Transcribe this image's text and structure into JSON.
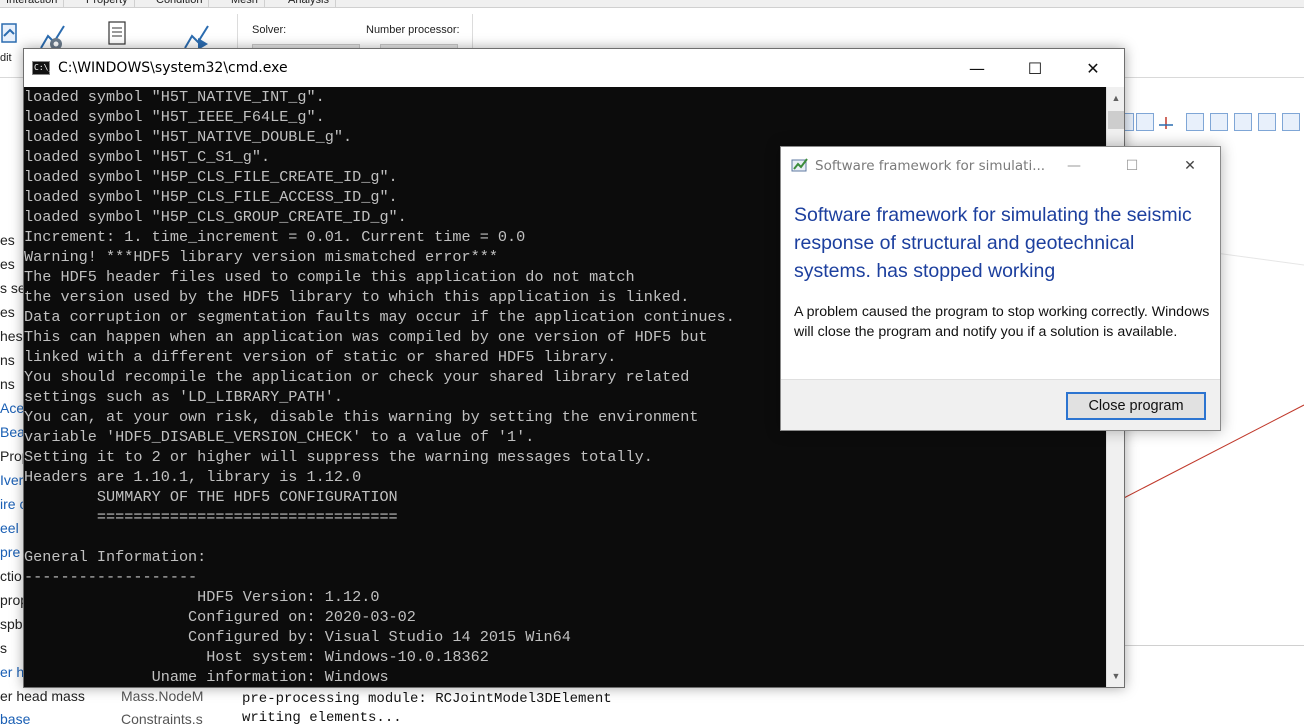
{
  "ribbon": {
    "tabs": [
      "Interaction",
      "Property",
      "Condition",
      "Mesh",
      "Analysis"
    ],
    "edit_label": "dit",
    "solver_label": "Solver:",
    "number_processor_label": "Number processor:"
  },
  "tree": {
    "left_items": [
      "es",
      "es",
      "s set",
      "es",
      "hes",
      "ns",
      "ns",
      "Acel",
      "Bear",
      "Prop",
      "Iver",
      "ire c",
      "eel",
      "pre",
      "ctio",
      "prop",
      "spb",
      "s",
      "er he",
      "er head mass",
      "base"
    ],
    "right_items": [
      "Mass.NodeM",
      "Constraints.s"
    ]
  },
  "output": {
    "lines": [
      "pre-processing module: RCJointModel3DElement",
      "writing elements..."
    ]
  },
  "cmd": {
    "title": "C:\\WINDOWS\\system32\\cmd.exe",
    "icon_text": "C:\\_",
    "minimize": "—",
    "maximize": "☐",
    "close": "✕",
    "lines": [
      "loaded symbol \"H5T_NATIVE_INT_g\".",
      "loaded symbol \"H5T_IEEE_F64LE_g\".",
      "loaded symbol \"H5T_NATIVE_DOUBLE_g\".",
      "loaded symbol \"H5T_C_S1_g\".",
      "loaded symbol \"H5P_CLS_FILE_CREATE_ID_g\".",
      "loaded symbol \"H5P_CLS_FILE_ACCESS_ID_g\".",
      "loaded symbol \"H5P_CLS_GROUP_CREATE_ID_g\".",
      "Increment: 1. time_increment = 0.01. Current time = 0.0",
      "Warning! ***HDF5 library version mismatched error***",
      "The HDF5 header files used to compile this application do not match",
      "the version used by the HDF5 library to which this application is linked.",
      "Data corruption or segmentation faults may occur if the application continues.",
      "This can happen when an application was compiled by one version of HDF5 but",
      "linked with a different version of static or shared HDF5 library.",
      "You should recompile the application or check your shared library related",
      "settings such as 'LD_LIBRARY_PATH'.",
      "You can, at your own risk, disable this warning by setting the environment",
      "variable 'HDF5_DISABLE_VERSION_CHECK' to a value of '1'.",
      "Setting it to 2 or higher will suppress the warning messages totally.",
      "Headers are 1.10.1, library is 1.12.0",
      "        SUMMARY OF THE HDF5 CONFIGURATION",
      "        =================================",
      "",
      "General Information:",
      "-------------------",
      "                   HDF5 Version: 1.12.0",
      "                  Configured on: 2020-03-02",
      "                  Configured by: Visual Studio 14 2015 Win64",
      "                    Host system: Windows-10.0.18362",
      "              Uname information: Windows"
    ],
    "scroll_up": "▲",
    "scroll_down": "▼"
  },
  "dialog": {
    "title": "Software framework for simulati...",
    "minimize": "—",
    "maximize": "☐",
    "close": "✕",
    "heading": "Software framework for simulating the seismic response of structural and geotechnical systems. has stopped working",
    "message": "A problem caused the program to stop working correctly. Windows will close the program and notify you if a solution is available.",
    "button_label": "Close program",
    "colors": {
      "heading": "#1c3f9e",
      "button_border": "#2c74d0"
    }
  },
  "colors": {
    "console_bg": "#0c0c0c",
    "console_text": "#c0c0c0",
    "drawing_line": "#c0392b"
  }
}
